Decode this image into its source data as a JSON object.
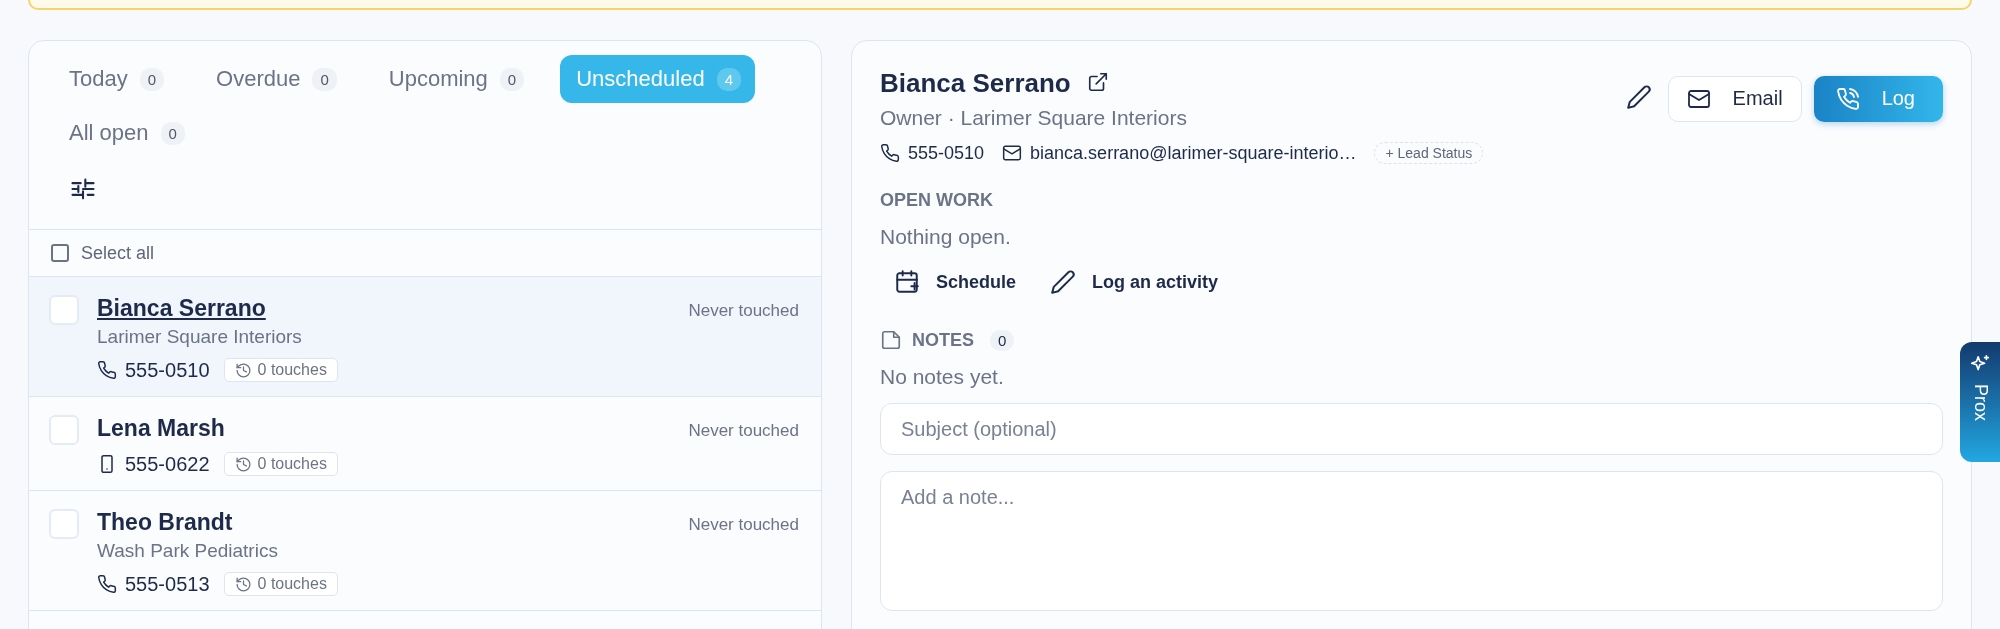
{
  "tabs": [
    {
      "label": "Today",
      "count": "0",
      "selected": false
    },
    {
      "label": "Overdue",
      "count": "0",
      "selected": false
    },
    {
      "label": "Upcoming",
      "count": "0",
      "selected": false
    },
    {
      "label": "Unscheduled",
      "count": "4",
      "selected": true
    },
    {
      "label": "All open",
      "count": "0",
      "selected": false
    }
  ],
  "select_all": {
    "label": "Select all",
    "checked": false
  },
  "contacts": [
    {
      "name": "Bianca Serrano",
      "company": "Larimer Square Interiors",
      "kind": "phone",
      "phone": "555-0510",
      "touches": "0 touches",
      "last_touch": "Never touched",
      "selected": true,
      "checked": false
    },
    {
      "name": "Lena Marsh",
      "kind": "mobile",
      "phone": "555-0622",
      "touches": "0 touches",
      "last_touch": "Never touched",
      "selected": false,
      "checked": false
    },
    {
      "name": "Theo Brandt",
      "company": "Wash Park Pediatrics",
      "kind": "phone",
      "phone": "555-0513",
      "touches": "0 touches",
      "last_touch": "Never touched",
      "selected": false,
      "checked": false
    }
  ],
  "detail": {
    "name": "Bianca Serrano",
    "subtitle": "Owner · Larimer Square Interiors",
    "phone": "555-0510",
    "email": "bianca.serrano@larimer-square-interio…",
    "lead_status": "+ Lead Status",
    "email_button": "Email",
    "log_button": "Log",
    "open_work": {
      "heading": "OPEN WORK",
      "empty_text": "Nothing open.",
      "actions": [
        {
          "kind": "schedule",
          "label": "Schedule"
        },
        {
          "kind": "log",
          "label": "Log an activity"
        }
      ]
    },
    "notes": {
      "heading": "NOTES",
      "count": "0",
      "empty_text": "No notes yet.",
      "subject_placeholder": "Subject (optional)",
      "note_placeholder": "Add a note..."
    }
  },
  "assistant_tab": {
    "label": "Prox"
  }
}
